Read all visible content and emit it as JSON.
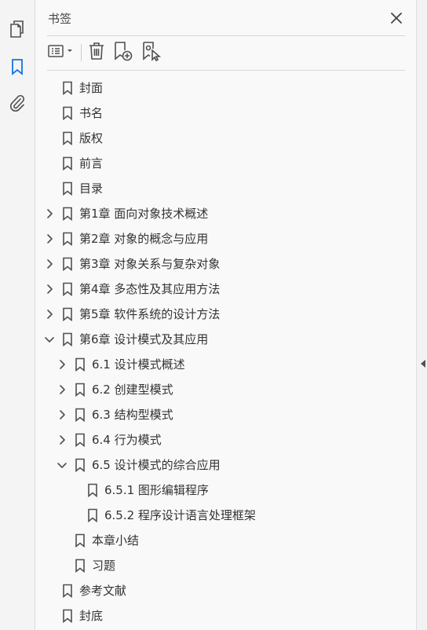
{
  "panel": {
    "title": "书签"
  },
  "toolbar": {
    "options": "options-menu",
    "delete": "delete-bookmark",
    "new": "new-bookmark",
    "new_from_selection": "new-bookmark-from-structure"
  },
  "colors": {
    "accent": "#1473e6",
    "icon": "#505050",
    "text": "#333333"
  },
  "bookmarks": [
    {
      "label": "封面",
      "level": 0,
      "expander": "none"
    },
    {
      "label": "书名",
      "level": 0,
      "expander": "none"
    },
    {
      "label": "版权",
      "level": 0,
      "expander": "none"
    },
    {
      "label": "前言",
      "level": 0,
      "expander": "none"
    },
    {
      "label": "目录",
      "level": 0,
      "expander": "none"
    },
    {
      "label": "第1章  面向对象技术概述",
      "level": 0,
      "expander": "collapsed"
    },
    {
      "label": "第2章  对象的概念与应用",
      "level": 0,
      "expander": "collapsed"
    },
    {
      "label": "第3章  对象关系与复杂对象",
      "level": 0,
      "expander": "collapsed"
    },
    {
      "label": "第4章  多态性及其应用方法",
      "level": 0,
      "expander": "collapsed"
    },
    {
      "label": "第5章  软件系统的设计方法",
      "level": 0,
      "expander": "collapsed"
    },
    {
      "label": "第6章  设计模式及其应用",
      "level": 0,
      "expander": "expanded"
    },
    {
      "label": "6.1  设计模式概述",
      "level": 1,
      "expander": "collapsed"
    },
    {
      "label": "6.2  创建型模式",
      "level": 1,
      "expander": "collapsed"
    },
    {
      "label": "6.3  结构型模式",
      "level": 1,
      "expander": "collapsed"
    },
    {
      "label": "6.4  行为模式",
      "level": 1,
      "expander": "collapsed"
    },
    {
      "label": "6.5  设计模式的综合应用",
      "level": 1,
      "expander": "expanded"
    },
    {
      "label": "6.5.1  图形编辑程序",
      "level": 2,
      "expander": "none"
    },
    {
      "label": "6.5.2  程序设计语言处理框架",
      "level": 2,
      "expander": "none"
    },
    {
      "label": "本章小结",
      "level": 1,
      "expander": "none"
    },
    {
      "label": "习题",
      "level": 1,
      "expander": "none"
    },
    {
      "label": "参考文献",
      "level": 0,
      "expander": "none"
    },
    {
      "label": "封底",
      "level": 0,
      "expander": "none"
    }
  ]
}
